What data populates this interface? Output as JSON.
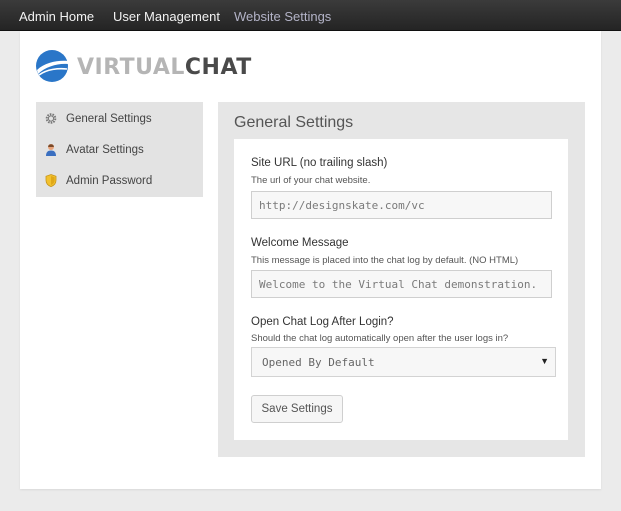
{
  "topnav": {
    "items": [
      "Admin Home",
      "User Management",
      "Website Settings"
    ],
    "active": "Website Settings"
  },
  "brand": {
    "part1": "VIRTUAL",
    "part2": "CHAT",
    "colors": {
      "globe": "#2a76c8",
      "part1": "#b5b5b5",
      "part2": "#4a4a4a"
    }
  },
  "sidebar": {
    "items": [
      {
        "label": "General Settings",
        "icon": "gear-icon"
      },
      {
        "label": "Avatar Settings",
        "icon": "user-icon"
      },
      {
        "label": "Admin Password",
        "icon": "shield-icon"
      }
    ]
  },
  "settings": {
    "title": "General Settings",
    "site_url": {
      "label": "Site URL (no trailing slash)",
      "help": "The url of your chat website.",
      "placeholder": "http://designskate.com/vc"
    },
    "welcome": {
      "label": "Welcome Message",
      "help": "This message is placed into the chat log by default. (NO HTML)",
      "placeholder": "Welcome to the Virtual Chat demonstration."
    },
    "chatlog": {
      "label": "Open Chat Log After Login?",
      "help": "Should the chat log automatically open after the user logs in?",
      "selected": "Opened By Default",
      "caret": "▼"
    },
    "save_label": "Save Settings"
  }
}
